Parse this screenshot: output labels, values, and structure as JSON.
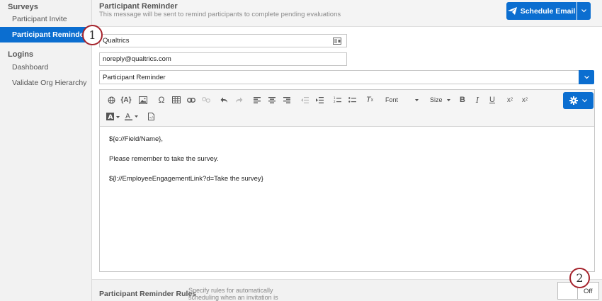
{
  "sidebar": {
    "sections": [
      {
        "title": "Surveys",
        "items": [
          "Participant Invite",
          "Participant Reminder"
        ]
      },
      {
        "title": "Logins",
        "items": [
          "Dashboard",
          "Validate Org Hierarchy"
        ]
      }
    ],
    "active_item": "Participant Reminder"
  },
  "header": {
    "title": "Participant Reminder",
    "subtitle": "This message will be sent to remind participants to complete pending evaluations",
    "schedule_label": "Schedule Email"
  },
  "form": {
    "from_name": "Qualtrics",
    "from_email": "noreply@qualtrics.com",
    "message_select": "Participant Reminder"
  },
  "toolbar": {
    "font_label": "Font",
    "size_label": "Size"
  },
  "message": {
    "line1": "${e://Field/Name},",
    "line2": "Please remember to take the survey.",
    "line3": "${l://EmployeeEngagementLink?d=Take the survey}"
  },
  "footer": {
    "rules_title": "Participant Reminder Rules",
    "rules_desc": "Specify rules for automatically scheduling when an invitation is",
    "toggle_label": "Off"
  },
  "callouts": [
    "1",
    "2"
  ],
  "colors": {
    "accent": "#0b6ed0",
    "callout": "#a5232c"
  }
}
